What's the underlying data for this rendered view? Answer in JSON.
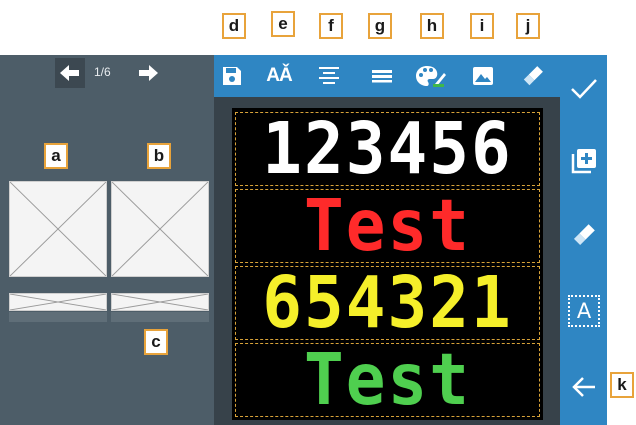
{
  "pager": {
    "indicator": "1/6"
  },
  "led_lines": [
    {
      "text": "123456",
      "color": "#ffffff"
    },
    {
      "text": "Test",
      "color": "#ff2a2a"
    },
    {
      "text": "654321",
      "color": "#f5ef2a"
    },
    {
      "text": "Test",
      "color": "#4fcf4f"
    }
  ],
  "toolbar": {
    "tools": [
      {
        "icon": "save-icon"
      },
      {
        "icon": "font-size-icon",
        "glyph": "AǍ"
      },
      {
        "icon": "align-center-icon"
      },
      {
        "icon": "line-spacing-icon"
      },
      {
        "icon": "palette-icon"
      },
      {
        "icon": "image-icon"
      },
      {
        "icon": "eraser-icon"
      }
    ]
  },
  "right_bar": {
    "buttons": [
      {
        "icon": "checkmark-icon"
      },
      {
        "icon": "add-page-icon"
      },
      {
        "icon": "eraser-icon"
      },
      {
        "icon": "text-box-icon",
        "glyph": "A"
      },
      {
        "icon": "back-arrow-icon"
      }
    ]
  },
  "callouts": {
    "a": "a",
    "b": "b",
    "c": "c",
    "d": "d",
    "e": "e",
    "f": "f",
    "g": "g",
    "h": "h",
    "i": "i",
    "j": "j",
    "k": "k"
  },
  "colors": {
    "toolbar_blue": "#2f86c3",
    "panel_gray": "#4d5d68",
    "callout_border": "#e8a33b",
    "guide_dashes": "#d8a339"
  }
}
